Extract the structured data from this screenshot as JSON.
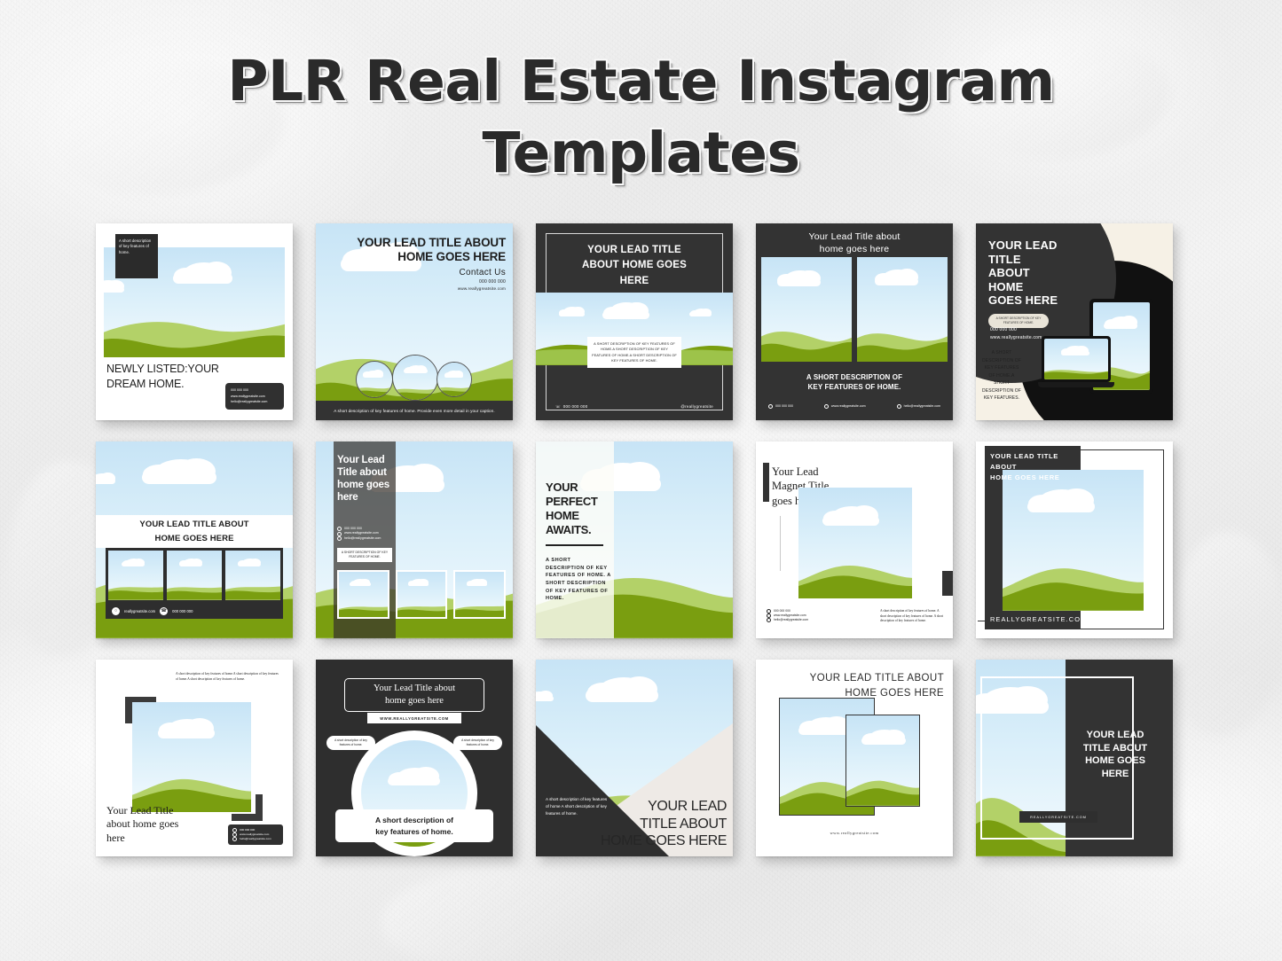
{
  "page": {
    "title_line_1": "PLR Real Estate Instagram",
    "title_line_2": "Templates",
    "background_color": "#f0f0f0"
  },
  "colors": {
    "green_dark": "#7a9e10",
    "green_light": "#b3d168",
    "sky_top": "#c7e4f6",
    "sky_bottom": "#f2fafd",
    "charcoal": "#333333",
    "cream": "#f6f1e6",
    "white": "#ffffff"
  },
  "common": {
    "phone": "000 000 000",
    "website": "www.reallygreatsite.com",
    "website_short": "reallygreatsite.com",
    "website_caps": "WWW.REALLYGREATSITE.COM",
    "website_caps_short": "REALLYGREATSITE.COM",
    "email": "hello@reallygreatsite.com",
    "handle": "@reallygreatsite",
    "desc_short": "A short description of key features of home.",
    "desc_long": "A short description of key features of home. A short description of key features of home.",
    "desc_caps": "A SHORT DESCRIPTION OF KEY FEATURES OF HOME."
  },
  "templates": [
    {
      "id": "t1",
      "note": "A short description of key features of home.",
      "title": "NEWLY LISTED:YOUR DREAM HOME.",
      "phone": "000 000 000",
      "website": "www.reallygreatsite.com",
      "email": "hello@reallygreatsite.com"
    },
    {
      "id": "t2",
      "title_line_1": "YOUR LEAD TITLE ABOUT",
      "title_line_2": "HOME GOES HERE",
      "contact_heading": "Contact Us",
      "phone": "000 000 000",
      "website": "www.reallygreatsite.com",
      "footer": "A short description of key features of home. Provide even more detail in your caption."
    },
    {
      "id": "t3",
      "title_line_1": "YOUR LEAD TITLE",
      "title_line_2": "ABOUT HOME GOES",
      "title_line_3": "HERE",
      "description": "A SHORT DESCRIPTION OF KEY FEATURES OF HOME.A SHORT DESCRIPTION OF KEY FEATURES OF HOME.A SHORT DESCRIPTION OF KEY FEATURES OF HOME.",
      "phone": "000  000 000",
      "handle": "@reallygreatsite"
    },
    {
      "id": "t4",
      "title_line_1": "Your Lead Title about",
      "title_line_2": "home goes here",
      "subtitle_line_1": "A SHORT DESCRIPTION OF",
      "subtitle_line_2": "KEY FEATURES OF HOME.",
      "phone": "000 000 000",
      "website": "www.reallygreatsite.com",
      "email": "hello@reallygreatsite.com"
    },
    {
      "id": "t5",
      "title_line_1": "YOUR LEAD",
      "title_line_2": "TITLE",
      "title_line_3": "ABOUT",
      "title_line_4": "HOME",
      "title_line_5": "GOES HERE",
      "pill": "A SHORT DESCRIPTION OF KEY FEATURES OF HOME.",
      "phone": "000 000 000",
      "website": "www.reallygreatsite.com",
      "side_text": "A SHORT DESCRIPTION OF KEY FEATURES OF HOME.A SHORT DESCRIPTION OF KEY FEATURES."
    },
    {
      "id": "t6",
      "title_line_1": "YOUR LEAD TITLE ABOUT",
      "title_line_2": "HOME GOES HERE",
      "website": "reallygreatsite.com",
      "phone": "000 000 000"
    },
    {
      "id": "t7",
      "title": "Your Lead Title about home goes here",
      "phone": "000 000 000",
      "website": "www.reallygreatsite.com",
      "email": "hello@reallygreatsite.com",
      "box": "A SHORT DESCRIPTION OF KEY FEATURES OF HOME."
    },
    {
      "id": "t8",
      "title_line_1": "YOUR",
      "title_line_2": "PERFECT",
      "title_line_3": "HOME",
      "title_line_4": "AWAITS.",
      "description": "A SHORT DESCRIPTION OF KEY FEATURES OF HOME. A SHORT DESCRIPTION OF KEY FEATURES OF HOME."
    },
    {
      "id": "t9",
      "title_line_1": "Your Lead",
      "title_line_2": "Magnet Title",
      "title_line_3": "goes here",
      "phone": "000 000 000",
      "website": "www.reallygreatsite.com",
      "email": "hello@reallygreatsite.com",
      "description": "A short description of key features of home. A short description of key features of home. A short description of key features of home."
    },
    {
      "id": "t10",
      "title_line_1": "YOUR LEAD TITLE ABOUT",
      "title_line_2": "HOME GOES HERE",
      "url": "REALLYGREATSITE.COM"
    },
    {
      "id": "t11",
      "description": "A short description of key features of home.A short description of key features of home.A short description of key features of home.",
      "title_line_1": "Your Lead Title",
      "title_line_2": "about home goes",
      "title_line_3": "here",
      "phone": "000 000 000",
      "website": "www.reallygreatsite.com",
      "email": "hello@reallygreatsite.com"
    },
    {
      "id": "t12",
      "title_line_1": "Your Lead Title about",
      "title_line_2": "home goes here",
      "url": "WWW.REALLYGREATSITE.COM",
      "pill_left": "A short description of key features of home.",
      "pill_right": "A short description of key features of home.",
      "bottom_line_1": "A short description of",
      "bottom_line_2": "key features of home."
    },
    {
      "id": "t13",
      "description": "A short description of key features of home A short description of key features of home.",
      "title_line_1": "YOUR LEAD",
      "title_line_2": "TITLE ABOUT",
      "title_line_3": "HOME GOES HERE"
    },
    {
      "id": "t14",
      "title_line_1": "YOUR LEAD TITLE ABOUT",
      "title_line_2": "HOME GOES HERE",
      "url": "www.reallygreatsite.com"
    },
    {
      "id": "t15",
      "title_line_1": "YOUR LEAD",
      "title_line_2": "TITLE ABOUT",
      "title_line_3": "HOME GOES",
      "title_line_4": "HERE",
      "url": "REALLYGREATSITE.COM"
    }
  ]
}
